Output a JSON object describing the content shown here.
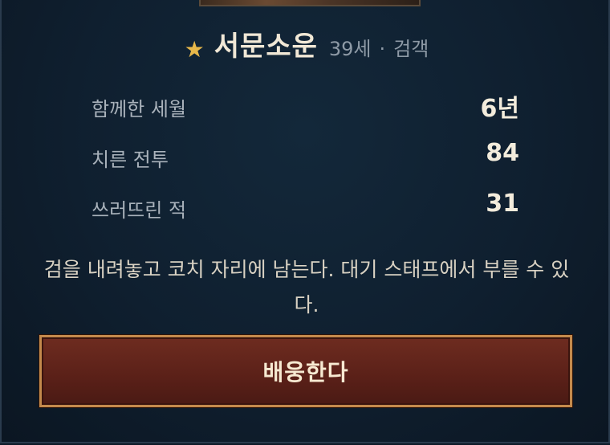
{
  "character": {
    "name": "서문소운",
    "age": "39세",
    "separator": "·",
    "class": "검객",
    "favorite": true
  },
  "stats": [
    {
      "label": "함께한 세월",
      "value": "6년"
    },
    {
      "label": "치른 전투",
      "value": "84"
    },
    {
      "label": "쓰러뜨린 적",
      "value": "31"
    }
  ],
  "description": "검을 내려놓고 코치 자리에 남는다. 대기 스태프에서 부를 수 있다.",
  "action": {
    "label": "배웅한다"
  },
  "colors": {
    "star": "#e8b84a",
    "button_border": "#c48a4c",
    "button_fill": "#5a2018",
    "background": "#0f1f2f"
  }
}
